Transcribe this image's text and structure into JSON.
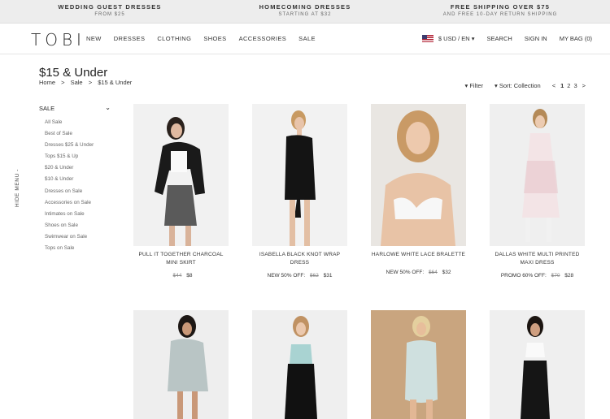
{
  "promo": [
    {
      "title": "Wedding Guest Dresses",
      "sub": "From $25"
    },
    {
      "title": "Homecoming Dresses",
      "sub": "Starting at $32"
    },
    {
      "title": "Free Shipping Over $75",
      "sub": "And free 10-day return shipping"
    }
  ],
  "nav": {
    "logo": "TOBI",
    "links": [
      "NEW",
      "DRESSES",
      "CLOTHING",
      "SHOES",
      "ACCESSORIES",
      "SALE"
    ],
    "locale": "$ USD / EN ▾",
    "search": "SEARCH",
    "signin": "SIGN IN",
    "bag": "MY BAG (0)"
  },
  "page": {
    "title": "$15 & Under",
    "breadcrumb": [
      "Home",
      ">",
      "Sale",
      ">",
      "$15 & Under"
    ],
    "filter": "▾ Filter",
    "sort": "▾ Sort: Collection",
    "pages": [
      "<",
      "1",
      "2",
      "3",
      ">"
    ]
  },
  "sidebar": {
    "heading": "SALE",
    "items": [
      "All Sale",
      "Best of Sale",
      "Dresses $25 & Under",
      "Tops $15 & Up",
      "$20 & Under",
      "$10 & Under",
      "Dresses on Sale",
      "Accessories on Sale",
      "Intimates on Sale",
      "Shoes on Sale",
      "Swimwear on Sale",
      "Tops on Sale"
    ],
    "hide_menu": "HIDE MENU -"
  },
  "products": [
    {
      "name": "PULL IT TOGETHER CHARCOAL MINI SKIRT",
      "prefix": "",
      "was": "$44",
      "now": "$8",
      "bg": "#f1f1f1"
    },
    {
      "name": "ISABELLA BLACK KNOT WRAP DRESS",
      "prefix": "NEW 50% OFF:",
      "was": "$62",
      "now": "$31",
      "bg": "#f2f2f2"
    },
    {
      "name": "HARLOWE WHITE LACE BRALETTE",
      "prefix": "NEW 50% OFF:",
      "was": "$64",
      "now": "$32",
      "bg": "#e9e6e2"
    },
    {
      "name": "DALLAS WHITE MULTI PRINTED MAXI DRESS",
      "prefix": "PROMO 60% OFF:",
      "was": "$70",
      "now": "$28",
      "bg": "#efefef"
    },
    {
      "name": "",
      "prefix": "",
      "was": "",
      "now": "",
      "bg": "#eeeeee"
    },
    {
      "name": "",
      "prefix": "",
      "was": "",
      "now": "",
      "bg": "#efefef"
    },
    {
      "name": "",
      "prefix": "",
      "was": "",
      "now": "",
      "bg": "#c9a57f"
    },
    {
      "name": "",
      "prefix": "",
      "was": "",
      "now": "",
      "bg": "#efefef"
    }
  ]
}
